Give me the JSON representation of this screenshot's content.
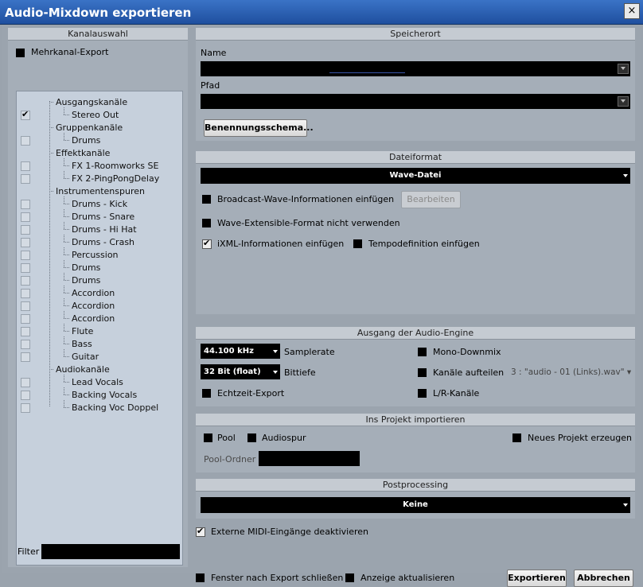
{
  "window": {
    "title": "Audio-Mixdown exportieren",
    "close": "×"
  },
  "channels": {
    "header": "Kanalauswahl",
    "multichannel": "Mehrkanal-Export",
    "tree": [
      {
        "label": "Ausgangskanäle",
        "level": 0,
        "checkbox": false,
        "checked": false
      },
      {
        "label": "Stereo Out",
        "level": 1,
        "checkbox": true,
        "checked": true
      },
      {
        "label": "Gruppenkanäle",
        "level": 0,
        "checkbox": false,
        "checked": false
      },
      {
        "label": "Drums",
        "level": 1,
        "checkbox": true,
        "checked": false
      },
      {
        "label": "Effektkanäle",
        "level": 0,
        "checkbox": false,
        "checked": false
      },
      {
        "label": "FX 1-Roomworks SE",
        "level": 1,
        "checkbox": true,
        "checked": false
      },
      {
        "label": "FX 2-PingPongDelay",
        "level": 1,
        "checkbox": true,
        "checked": false
      },
      {
        "label": "Instrumentenspuren",
        "level": 0,
        "checkbox": false,
        "checked": false
      },
      {
        "label": "Drums - Kick",
        "level": 1,
        "checkbox": true,
        "checked": false
      },
      {
        "label": "Drums - Snare",
        "level": 1,
        "checkbox": true,
        "checked": false
      },
      {
        "label": "Drums - Hi Hat",
        "level": 1,
        "checkbox": true,
        "checked": false
      },
      {
        "label": "Drums - Crash",
        "level": 1,
        "checkbox": true,
        "checked": false
      },
      {
        "label": "Percussion",
        "level": 1,
        "checkbox": true,
        "checked": false
      },
      {
        "label": "Drums",
        "level": 1,
        "checkbox": true,
        "checked": false
      },
      {
        "label": "Drums",
        "level": 1,
        "checkbox": true,
        "checked": false
      },
      {
        "label": "Accordion",
        "level": 1,
        "checkbox": true,
        "checked": false
      },
      {
        "label": "Accordion",
        "level": 1,
        "checkbox": true,
        "checked": false
      },
      {
        "label": "Accordion",
        "level": 1,
        "checkbox": true,
        "checked": false
      },
      {
        "label": "Flute",
        "level": 1,
        "checkbox": true,
        "checked": false
      },
      {
        "label": "Bass",
        "level": 1,
        "checkbox": true,
        "checked": false
      },
      {
        "label": "Guitar",
        "level": 1,
        "checkbox": true,
        "checked": false
      },
      {
        "label": "Audiokanäle",
        "level": 0,
        "checkbox": false,
        "checked": false
      },
      {
        "label": "Lead Vocals",
        "level": 1,
        "checkbox": true,
        "checked": false
      },
      {
        "label": "Backing Vocals",
        "level": 1,
        "checkbox": true,
        "checked": false
      },
      {
        "label": "Backing Voc Doppel",
        "level": 1,
        "checkbox": true,
        "checked": false
      }
    ],
    "filter_label": "Filter",
    "filter_value": ""
  },
  "location": {
    "header": "Speicherort",
    "name_label": "Name",
    "name_value": "",
    "path_label": "Pfad",
    "path_value": "",
    "naming_button": "Benennungsschema..."
  },
  "format": {
    "header": "Dateiformat",
    "selected": "Wave-Datei",
    "bwf": "Broadcast-Wave-Informationen einfügen",
    "edit_button": "Bearbeiten",
    "wave_ext": "Wave-Extensible-Format nicht verwenden",
    "ixml": "iXML-Informationen einfügen",
    "tempo": "Tempodefinition einfügen"
  },
  "engine": {
    "header": "Ausgang der Audio-Engine",
    "samplerate_value": "44.100 kHz",
    "samplerate_label": "Samplerate",
    "bitdepth_value": "32 Bit (float)",
    "bitdepth_label": "Bittiefe",
    "realtime": "Echtzeit-Export",
    "mono": "Mono-Downmix",
    "split": "Kanäle aufteilen",
    "split_value": "3 : \"audio - 01 (Links).wav\"",
    "lr": "L/R-Kanäle"
  },
  "import": {
    "header": "Ins Projekt importieren",
    "pool": "Pool",
    "audiotrack": "Audiospur",
    "new_project": "Neues Projekt erzeugen",
    "pool_folder_label": "Pool-Ordner",
    "pool_folder_value": ""
  },
  "post": {
    "header": "Postprocessing",
    "selected": "Keine"
  },
  "footer": {
    "midi": "Externe MIDI-Eingänge deaktivieren",
    "close_after": "Fenster nach Export schließen",
    "update_display": "Anzeige aktualisieren",
    "export_button": "Exportieren",
    "cancel_button": "Abbrechen"
  }
}
